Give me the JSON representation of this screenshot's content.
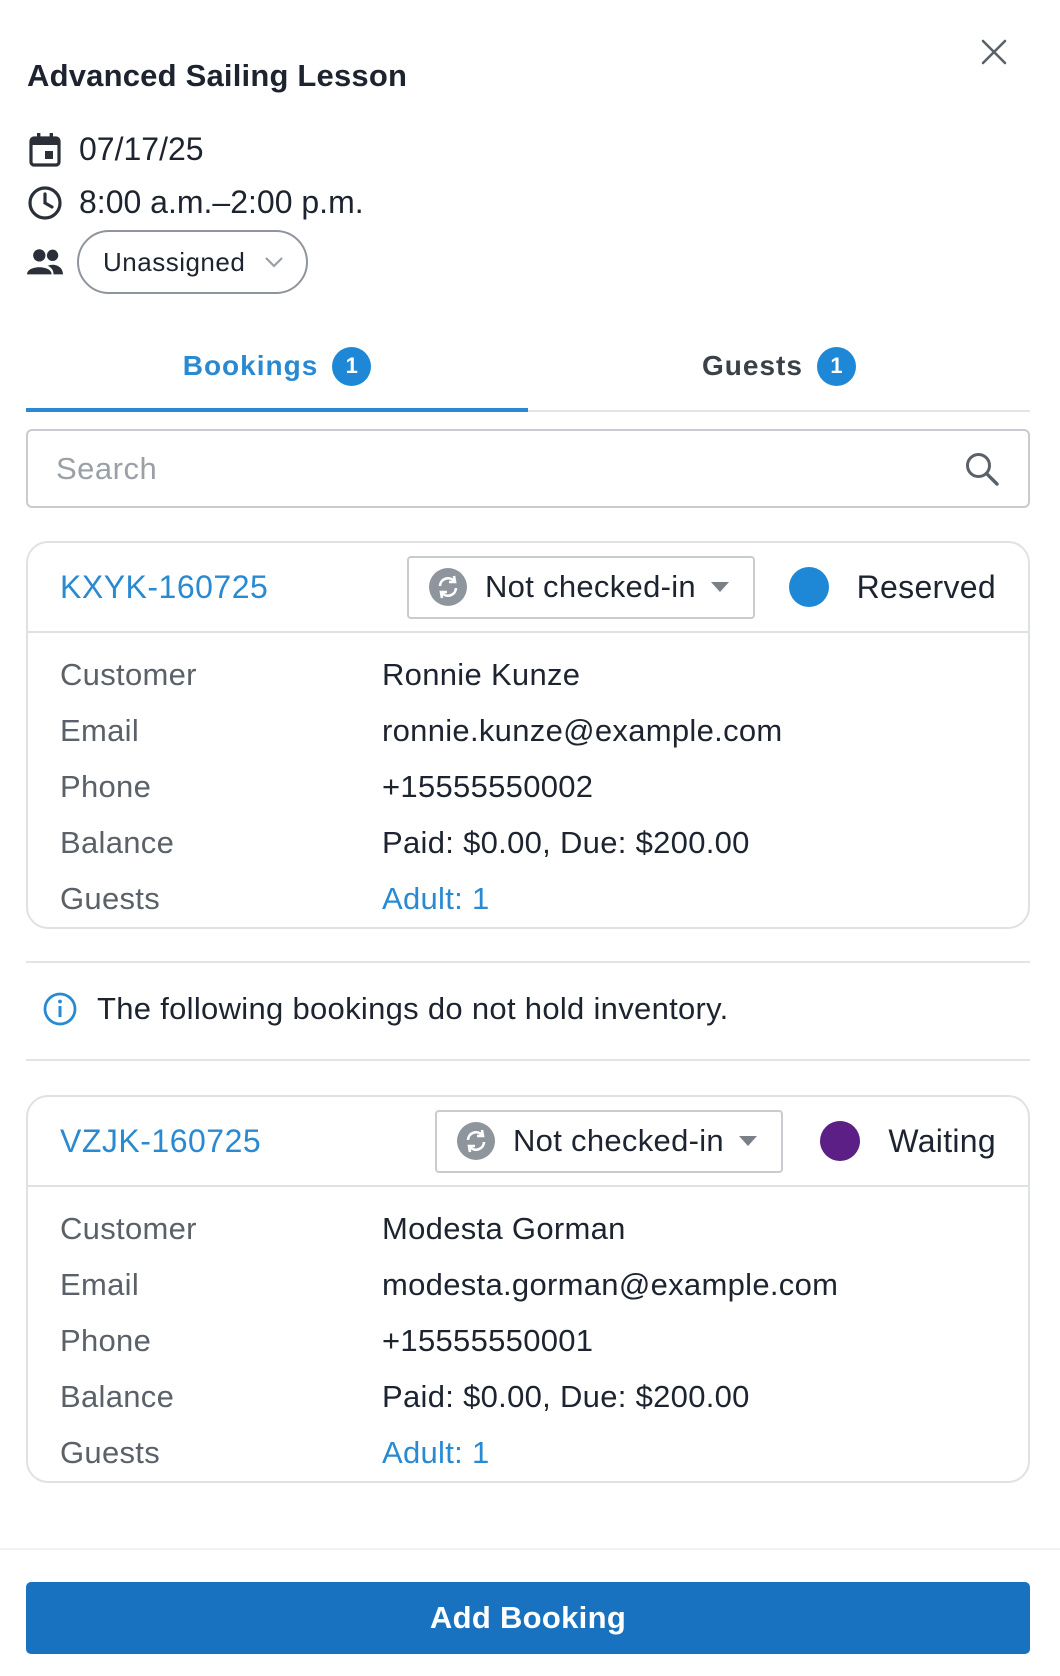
{
  "header": {
    "title": "Advanced Sailing Lesson",
    "date": "07/17/25",
    "time": "8:00 a.m.–2:00 p.m.",
    "staff_select": "Unassigned"
  },
  "tabs": [
    {
      "label": "Bookings",
      "count": "1",
      "active": true
    },
    {
      "label": "Guests",
      "count": "1",
      "active": false
    }
  ],
  "search": {
    "placeholder": "Search",
    "value": ""
  },
  "bookings": [
    {
      "id": "KXYK-160725",
      "checkin": "Not checked-in",
      "status": "Reserved",
      "status_color": "#1e88d6",
      "fields": [
        {
          "label": "Customer",
          "value": "Ronnie Kunze"
        },
        {
          "label": "Email",
          "value": "ronnie.kunze@example.com"
        },
        {
          "label": "Phone",
          "value": "+15555550002"
        },
        {
          "label": "Balance",
          "value": "Paid: $0.00, Due: $200.00"
        },
        {
          "label": "Guests",
          "value": "Adult: 1"
        }
      ]
    },
    {
      "id": "VZJK-160725",
      "checkin": "Not checked-in",
      "status": "Waiting",
      "status_color": "#5b1f86",
      "fields": [
        {
          "label": "Customer",
          "value": "Modesta Gorman"
        },
        {
          "label": "Email",
          "value": "modesta.gorman@example.com"
        },
        {
          "label": "Phone",
          "value": "+15555550001"
        },
        {
          "label": "Balance",
          "value": "Paid: $0.00, Due: $200.00"
        },
        {
          "label": "Guests",
          "value": "Adult: 1"
        }
      ]
    }
  ],
  "notice": "The following bookings do not hold inventory.",
  "footer": {
    "add_button": "Add Booking"
  },
  "colors": {
    "accent": "#2a8ad1",
    "primary_button": "#1872c0"
  },
  "icons": [
    "close-icon",
    "calendar-icon",
    "clock-icon",
    "people-icon",
    "chevron-down-icon",
    "search-icon",
    "sync-icon",
    "caret-down-icon",
    "info-icon"
  ]
}
